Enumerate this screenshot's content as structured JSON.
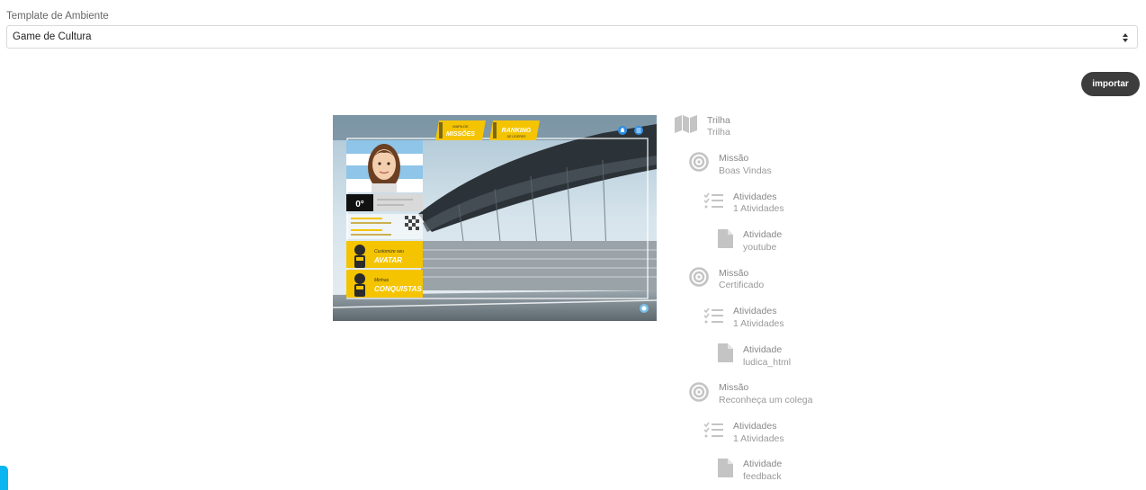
{
  "template": {
    "label": "Template de Ambiente",
    "selected": "Game de Cultura"
  },
  "actions": {
    "import_label": "importar"
  },
  "preview": {
    "missions_button": "MISSÕES",
    "missions_small": "MAPA DE",
    "ranking_button": "RANKING",
    "ranking_small": "DE LÍDERES",
    "score": "0°",
    "avatar_button_small": "Customize seu",
    "avatar_button": "AVATAR",
    "achievements_small": "Minhas",
    "achievements_button": "CONQUISTAS"
  },
  "tree": {
    "trilha": {
      "type": "Trilha",
      "name": "Trilha"
    },
    "missions": [
      {
        "type": "Missão",
        "name": "Boas Vindas",
        "activities_type": "Atividades",
        "activities_count": "1 Atividades",
        "activity_type": "Atividade",
        "activity_name": "youtube"
      },
      {
        "type": "Missão",
        "name": "Certificado",
        "activities_type": "Atividades",
        "activities_count": "1 Atividades",
        "activity_type": "Atividade",
        "activity_name": "ludica_html"
      },
      {
        "type": "Missão",
        "name": "Reconheça um colega",
        "activities_type": "Atividades",
        "activities_count": "1 Atividades",
        "activity_type": "Atividade",
        "activity_name": "feedback"
      }
    ]
  },
  "colors": {
    "accent": "#0bb5ef",
    "button_bg": "#3d3d3d",
    "preview_yellow": "#f5c400",
    "tree_icon": "#c4c4c4"
  }
}
